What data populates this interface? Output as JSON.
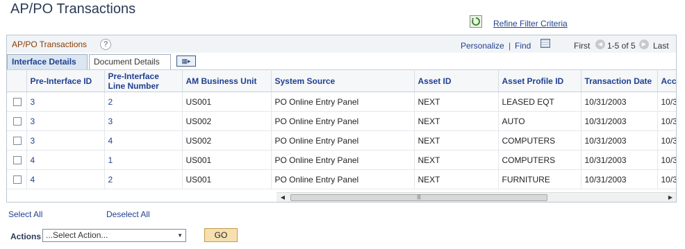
{
  "page": {
    "title": "AP/PO Transactions",
    "refine_link": "Refine Filter Criteria"
  },
  "grid": {
    "title": "AP/PO Transactions",
    "help": "?",
    "personalize": "Personalize",
    "sep": "|",
    "find": "Find",
    "first": "First",
    "range": "1-5 of 5",
    "last": "Last",
    "tabs": [
      "Interface Details",
      "Document Details"
    ],
    "columns": [
      "Pre-Interface ID",
      "Pre-Interface Line Number",
      "AM Business Unit",
      "System Source",
      "Asset ID",
      "Asset Profile ID",
      "Transaction Date",
      "Acco"
    ],
    "rows": [
      [
        "3",
        "2",
        "US001",
        "PO Online Entry Panel",
        "NEXT",
        "LEASED EQT",
        "10/31/2003",
        "10/3"
      ],
      [
        "3",
        "3",
        "US002",
        "PO Online Entry Panel",
        "NEXT",
        "AUTO",
        "10/31/2003",
        "10/3"
      ],
      [
        "3",
        "4",
        "US002",
        "PO Online Entry Panel",
        "NEXT",
        "COMPUTERS",
        "10/31/2003",
        "10/3"
      ],
      [
        "4",
        "1",
        "US001",
        "PO Online Entry Panel",
        "NEXT",
        "COMPUTERS",
        "10/31/2003",
        "10/3"
      ],
      [
        "4",
        "2",
        "US001",
        "PO Online Entry Panel",
        "NEXT",
        "FURNITURE",
        "10/31/2003",
        "10/3"
      ]
    ]
  },
  "footer": {
    "select_all": "Select All",
    "deselect_all": "Deselect All",
    "actions_label": "Actions",
    "actions_value": "...Select Action...",
    "go": "GO"
  },
  "icons": {
    "refresh": "refresh-icon",
    "help": "help-icon",
    "download": "download-icon",
    "expand": "expand-grid-icon"
  },
  "colors": {
    "link": "#1f3f8f",
    "grid_title": "#8a3a00",
    "go_button": "#f6e0b0"
  }
}
